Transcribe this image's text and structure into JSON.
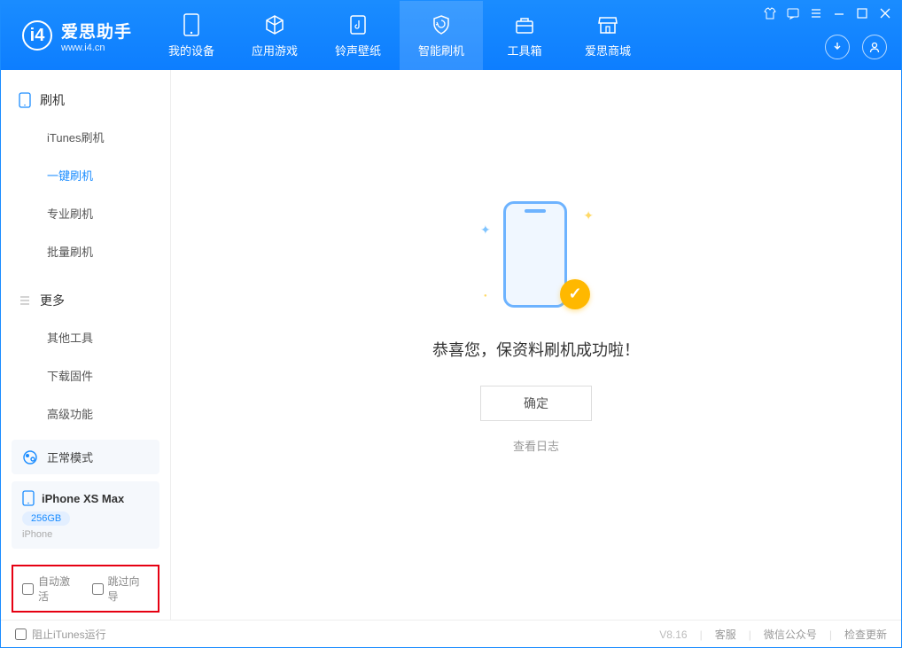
{
  "app": {
    "title": "爱思助手",
    "url": "www.i4.cn"
  },
  "header_tabs": [
    {
      "label": "我的设备",
      "icon": "device"
    },
    {
      "label": "应用游戏",
      "icon": "cube"
    },
    {
      "label": "铃声壁纸",
      "icon": "music"
    },
    {
      "label": "智能刷机",
      "icon": "shield",
      "active": true
    },
    {
      "label": "工具箱",
      "icon": "toolbox"
    },
    {
      "label": "爱思商城",
      "icon": "store"
    }
  ],
  "sidebar": {
    "section1_title": "刷机",
    "section1_items": [
      "iTunes刷机",
      "一键刷机",
      "专业刷机",
      "批量刷机"
    ],
    "section1_active_index": 1,
    "section2_title": "更多",
    "section2_items": [
      "其他工具",
      "下载固件",
      "高级功能"
    ]
  },
  "mode_box": {
    "label": "正常模式"
  },
  "device": {
    "name": "iPhone XS Max",
    "capacity": "256GB",
    "type": "iPhone"
  },
  "checkboxes": {
    "auto_activate": "自动激活",
    "skip_guide": "跳过向导"
  },
  "main": {
    "success_text": "恭喜您，保资料刷机成功啦！",
    "ok_button": "确定",
    "log_link": "查看日志"
  },
  "footer": {
    "block_itunes": "阻止iTunes运行",
    "version": "V8.16",
    "links": [
      "客服",
      "微信公众号",
      "检查更新"
    ]
  }
}
